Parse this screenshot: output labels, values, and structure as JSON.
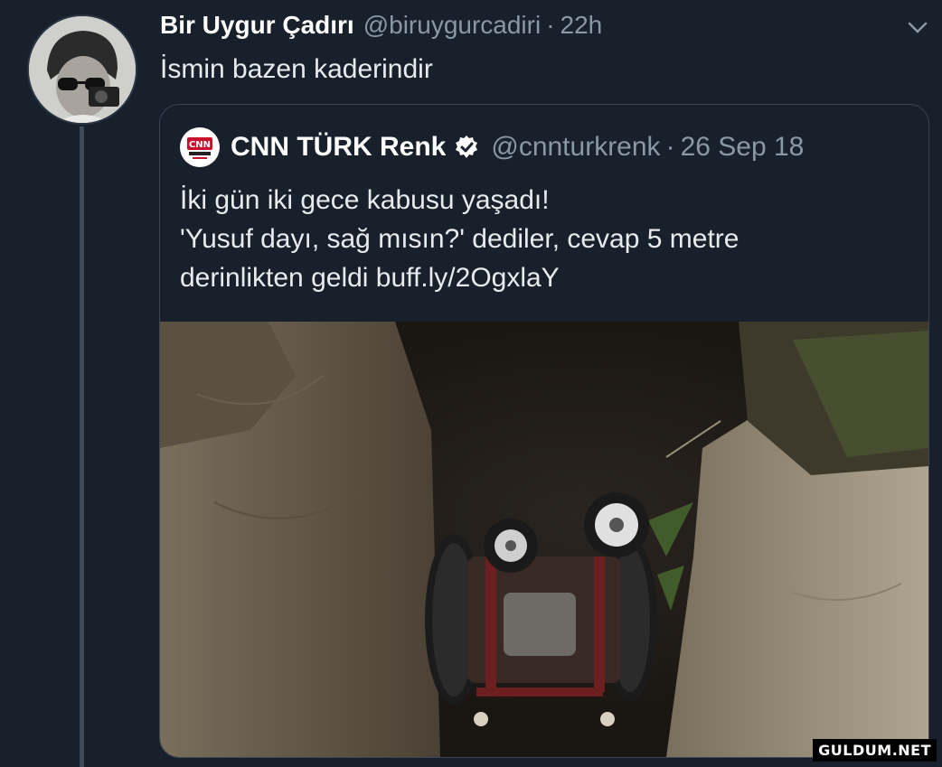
{
  "tweet": {
    "author_name": "Bir Uygur Çadırı",
    "author_handle": "@biruygurcadiri",
    "separator": "·",
    "time": "22h",
    "text": "İsmin bazen kaderindir"
  },
  "quoted_tweet": {
    "author_name": "CNN TÜRK Renk",
    "author_handle": "@cnnturkrenk",
    "separator": "·",
    "date": "26 Sep 18",
    "text_lines": [
      "İki gün iki gece kabusu yaşadı!",
      "'Yusuf dayı, sağ mısın?' dediler, cevap 5 metre",
      "derinlikten geldi buff.ly/2OgxlaY"
    ],
    "logo_text": "CNN",
    "verified_icon": "verified-badge-icon"
  },
  "watermark": "GULDUM.NET",
  "colors": {
    "background": "#17202b",
    "secondary_text": "#8a98a6",
    "thread_line": "#3c4a59"
  }
}
